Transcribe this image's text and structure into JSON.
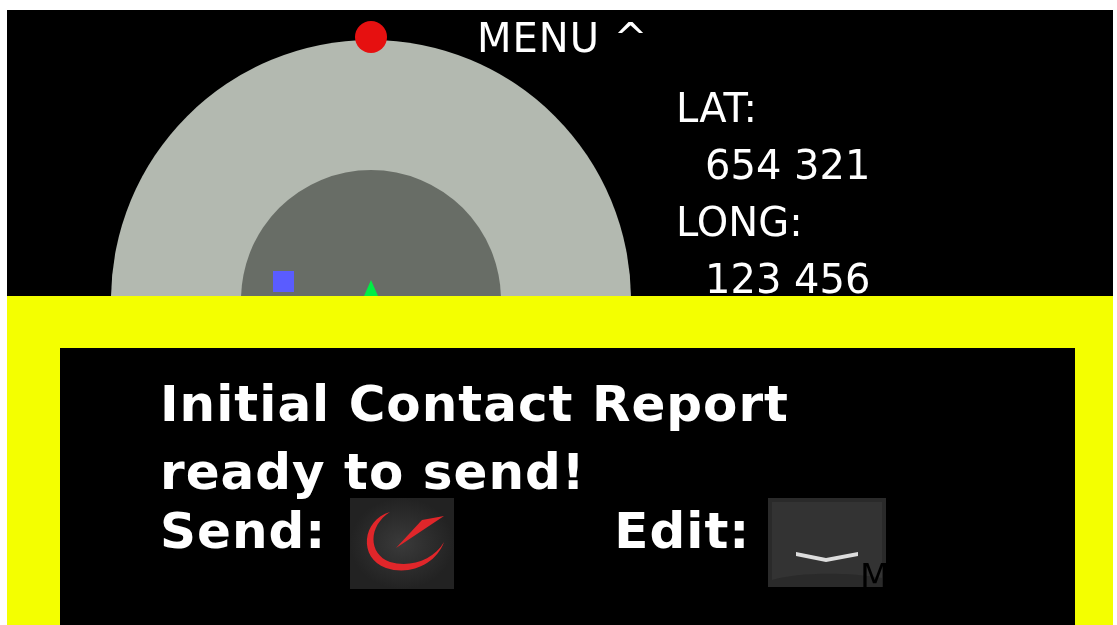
{
  "menu": {
    "label": "MENU",
    "caret": "^"
  },
  "position": [
    {
      "label": "LAT:",
      "value": "654 321"
    },
    {
      "label": "LONG:",
      "value": "123 456"
    }
  ],
  "alert": {
    "message": "Initial Contact Report\nready to send!",
    "actions": [
      {
        "kind": "send",
        "label": "Send:"
      },
      {
        "kind": "edit",
        "label": "Edit:",
        "key_text": "M"
      }
    ]
  }
}
